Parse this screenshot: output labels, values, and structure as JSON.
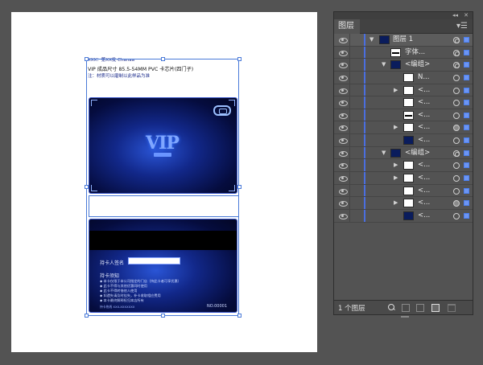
{
  "artboard": {
    "header_line1": "XXX：第XX批 Chanaa",
    "header_line2": "VIP 成品尺寸 85.5-54MM PVC 卡芯片(四门子)",
    "header_line3": "注：材质可以磨制以此样品为准",
    "front_card": {
      "logo_text": "VIP"
    },
    "back_card": {
      "signature_label": "持卡人签名",
      "notes_title": "持卡须知",
      "notes": [
        "◆ 本卡仅限于本公司指定的门店（持此卡者可享优惠）",
        "◆ 此卡不得与其他优惠同时使用",
        "◆ 此卡不得转借他人使用",
        "◆ 如遗失请及时挂失，补卡收取相应费用",
        "◆ 本卡最终解释权归本店所有"
      ],
      "footer_left": "持卡热线 XXX-XXXXXXX",
      "card_number": "NO.00001"
    }
  },
  "layers_panel": {
    "tab_label": "图层",
    "layers": [
      {
        "label": "图层 1",
        "arrow": "▼"
      },
      {
        "label": "字体..."
      },
      {
        "label": "<编组>",
        "arrow": "▼"
      },
      {
        "label": "N..."
      },
      {
        "label": "<...",
        "arrow": "▶"
      },
      {
        "label": "<..."
      },
      {
        "label": "<..."
      },
      {
        "label": "<...",
        "arrow": "▶"
      },
      {
        "label": "<..."
      },
      {
        "label": "<编组>",
        "arrow": "▼"
      },
      {
        "label": "<...",
        "arrow": "▶"
      },
      {
        "label": "<...",
        "arrow": "▶"
      },
      {
        "label": "<..."
      },
      {
        "label": "<...",
        "arrow": "▶"
      },
      {
        "label": "<..."
      }
    ],
    "footer_count": "1 个图层"
  }
}
